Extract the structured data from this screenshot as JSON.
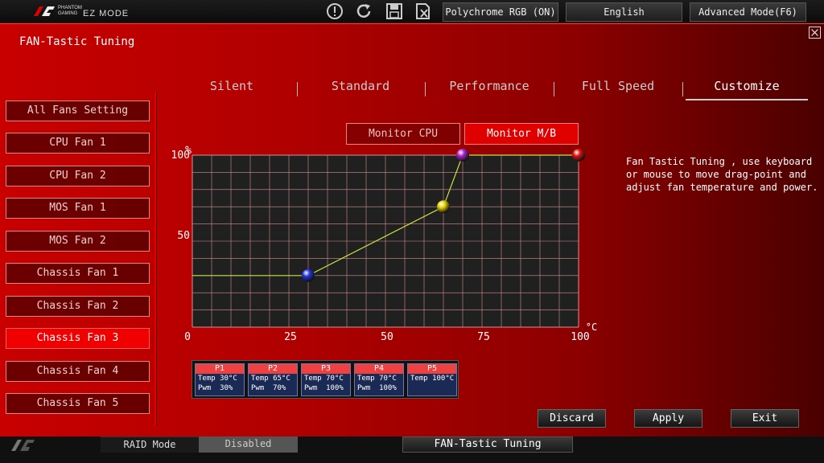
{
  "topbar": {
    "brand_line1": "PHANTOM",
    "brand_line2": "GAMING",
    "mode": "EZ MODE",
    "buttons": [
      {
        "label": "Polychrome RGB (ON)"
      },
      {
        "label": "English"
      },
      {
        "label": "Advanced Mode(F6)"
      }
    ]
  },
  "panel": {
    "title": "FAN-Tastic Tuning"
  },
  "sidebar": {
    "items": [
      {
        "label": "All Fans Setting"
      },
      {
        "label": "CPU Fan 1"
      },
      {
        "label": "CPU Fan 2"
      },
      {
        "label": "MOS Fan 1"
      },
      {
        "label": "MOS Fan 2"
      },
      {
        "label": "Chassis Fan 1"
      },
      {
        "label": "Chassis Fan 2"
      },
      {
        "label": "Chassis Fan 3"
      },
      {
        "label": "Chassis Fan 4"
      },
      {
        "label": "Chassis Fan 5"
      }
    ],
    "active_index": 7
  },
  "tabs": [
    {
      "label": "Silent"
    },
    {
      "label": "Standard"
    },
    {
      "label": "Performance"
    },
    {
      "label": "Full Speed"
    },
    {
      "label": "Customize"
    }
  ],
  "active_tab": 4,
  "monitor": {
    "cpu_label": "Monitor CPU",
    "mb_label": "Monitor M/B",
    "selected": "Monitor M/B"
  },
  "help_text": [
    "Fan Tastic Tuning , use keyboard",
    "or mouse to move drag-point and",
    "adjust fan temperature and power."
  ],
  "chart_data": {
    "type": "line",
    "ylabel": "%",
    "xlabel": "°C",
    "xlim": [
      0,
      100
    ],
    "ylim": [
      0,
      100
    ],
    "x_ticks": [
      "0",
      "25",
      "50",
      "75",
      "100"
    ],
    "y_ticks": [
      "100",
      "50"
    ],
    "grid": true,
    "series": [
      {
        "points": [
          {
            "x": 0,
            "y": 30
          },
          {
            "x": 30,
            "y": 30,
            "color": "#2233dd"
          },
          {
            "x": 65,
            "y": 70,
            "color": "#e6d000"
          },
          {
            "x": 70,
            "y": 100,
            "color": "#aa22cc"
          },
          {
            "x": 100,
            "y": 100,
            "color": "#dd1111"
          }
        ]
      }
    ]
  },
  "fan_points": [
    {
      "name": "P1",
      "temp": "Temp 30°C",
      "pwm": "Pwm  30%"
    },
    {
      "name": "P2",
      "temp": "Temp 65°C",
      "pwm": "Pwm  70%"
    },
    {
      "name": "P3",
      "temp": "Temp 70°C",
      "pwm": "Pwm  100%"
    },
    {
      "name": "P4",
      "temp": "Temp 70°C",
      "pwm": "Pwm  100%"
    },
    {
      "name": "P5",
      "temp": "Temp 100°C",
      "pwm": ""
    }
  ],
  "actions": [
    {
      "label": "Discard"
    },
    {
      "label": "Apply"
    },
    {
      "label": "Exit"
    }
  ],
  "footer": {
    "raid_label": "RAID Mode",
    "raid_value": "Disabled",
    "fan_tuning": "FAN-Tastic Tuning"
  },
  "colors": {
    "accent": "#e00000",
    "curve": "#c8e040",
    "grid": "#d89090"
  }
}
